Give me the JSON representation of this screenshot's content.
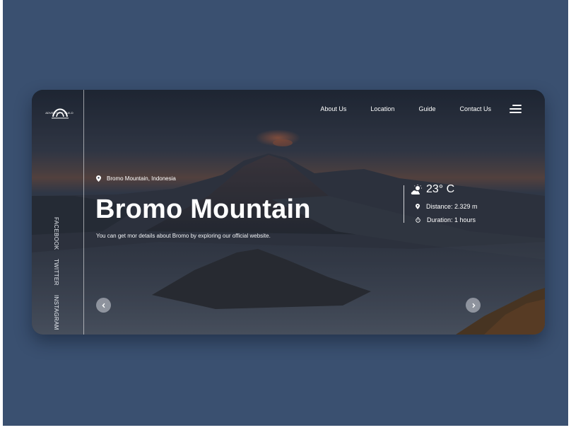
{
  "brand": {
    "logo_text": "ADVENTURE GUILD"
  },
  "nav": {
    "items": [
      "About Us",
      "Location",
      "Guide",
      "Contact Us"
    ],
    "menu_icon": "hamburger-menu-icon"
  },
  "social": {
    "items": [
      "FACEBOOK",
      "TWITTER",
      "INSTAGRAM"
    ]
  },
  "hero": {
    "location": "Bromo Mountain, Indonesia",
    "title": "Bromo Mountain",
    "description": "You can get mor details about Bromo by exploring our official website.",
    "location_icon": "map-pin-icon"
  },
  "weather": {
    "temperature": "23° C",
    "icon": "partly-cloudy-icon",
    "distance": "Distance: 2.329 m",
    "duration": "Duration: 1 hours",
    "distance_icon": "map-pin-icon",
    "duration_icon": "stopwatch-icon"
  },
  "carousel": {
    "prev_icon": "chevron-left-icon",
    "next_icon": "chevron-right-icon"
  },
  "colors": {
    "page_background": "#3a5070",
    "text": "#ffffff"
  }
}
